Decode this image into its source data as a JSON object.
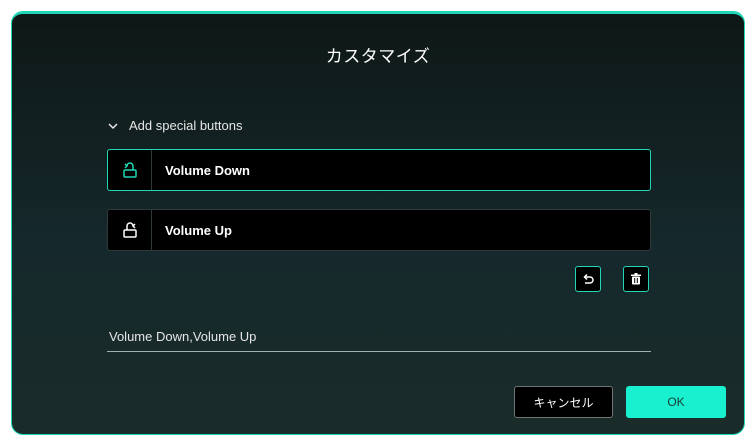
{
  "dialog": {
    "title": "カスタマイズ",
    "section_label": "Add special buttons",
    "buttons": [
      {
        "label": "Volume Down",
        "icon": "volume-down-icon",
        "selected": true
      },
      {
        "label": "Volume Up",
        "icon": "volume-up-icon",
        "selected": false
      }
    ],
    "result_value": "Volume Down,Volume Up",
    "cancel_label": "キャンセル",
    "ok_label": "OK"
  },
  "colors": {
    "accent": "#1fd7b6",
    "ok_fill": "#19f0cf",
    "row_bg": "#000000",
    "dialog_bg_top": "#0e1816",
    "dialog_bg_bottom": "#1a2c2a"
  }
}
